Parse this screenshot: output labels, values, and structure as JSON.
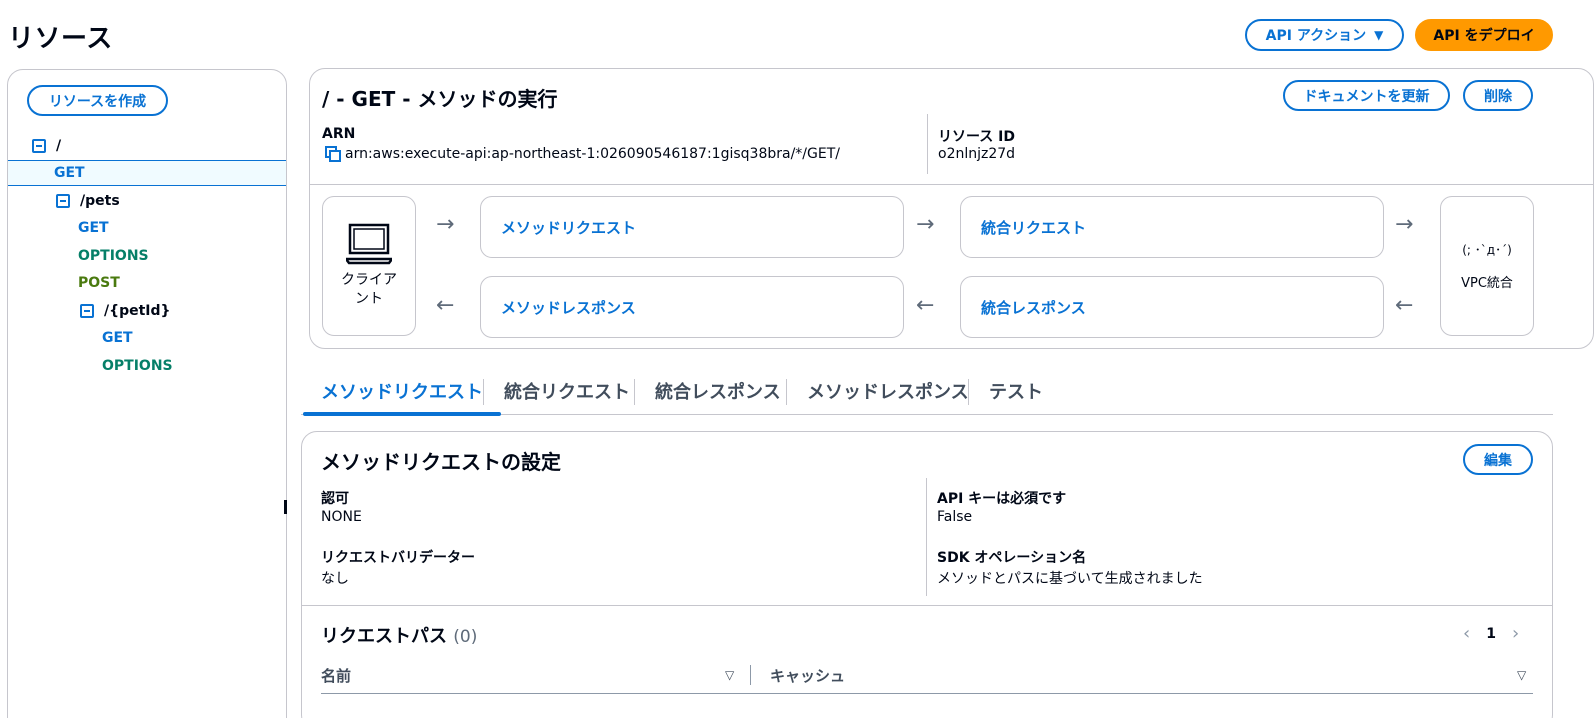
{
  "page": {
    "title": "リソース",
    "api_actions_label": "API アクション",
    "deploy_label": "API をデプロイ"
  },
  "sidebar": {
    "create_resource_label": "リソースを作成",
    "tree": [
      {
        "label": "/",
        "kind": "path"
      },
      {
        "label": "GET",
        "kind": "get",
        "selected": true
      },
      {
        "label": "/pets",
        "kind": "path"
      },
      {
        "label": "GET",
        "kind": "get"
      },
      {
        "label": "OPTIONS",
        "kind": "options"
      },
      {
        "label": "POST",
        "kind": "post"
      },
      {
        "label": "/{petId}",
        "kind": "path"
      },
      {
        "label": "GET",
        "kind": "get"
      },
      {
        "label": "OPTIONS",
        "kind": "options"
      }
    ]
  },
  "method": {
    "title": "/ - GET - メソッドの実行",
    "update_docs_label": "ドキュメントを更新",
    "delete_label": "削除",
    "arn_label": "ARN",
    "arn_value": "arn:aws:execute-api:ap-northeast-1:026090546187:1gisq38bra/*/GET/",
    "resource_id_label": "リソース ID",
    "resource_id_value": "o2nlnjz27d"
  },
  "flow": {
    "client_label": "クライアント",
    "method_request": "メソッドリクエスト",
    "integration_request": "統合リクエスト",
    "method_response": "メソッドレスポンス",
    "integration_response": "統合レスポンス",
    "vpc_face": "(; ･`д･´)",
    "vpc_label": "VPC統合",
    "arrow_right": "→",
    "arrow_left": "←"
  },
  "tabs": [
    {
      "label": "メソッドリクエスト",
      "active": true
    },
    {
      "label": "統合リクエスト"
    },
    {
      "label": "統合レスポンス"
    },
    {
      "label": "メソッドレスポンス"
    },
    {
      "label": "テスト"
    }
  ],
  "settings": {
    "title": "メソッドリクエストの設定",
    "edit_label": "編集",
    "auth_label": "認可",
    "auth_value": "NONE",
    "api_key_label": "API キーは必須です",
    "api_key_value": "False",
    "validator_label": "リクエストバリデーター",
    "validator_value": "なし",
    "sdk_label": "SDK オペレーション名",
    "sdk_value": "メソッドとパスに基づいて生成されました"
  },
  "request_paths": {
    "title": "リクエストパス",
    "count": "(0)",
    "page": "1",
    "prev": "‹",
    "next": "›",
    "col_name": "名前",
    "col_cache": "キャッシュ"
  },
  "colors": {
    "accent": "#0972d3",
    "deploy": "#ff9900",
    "options": "#067f68",
    "post": "#4a7a0f"
  }
}
